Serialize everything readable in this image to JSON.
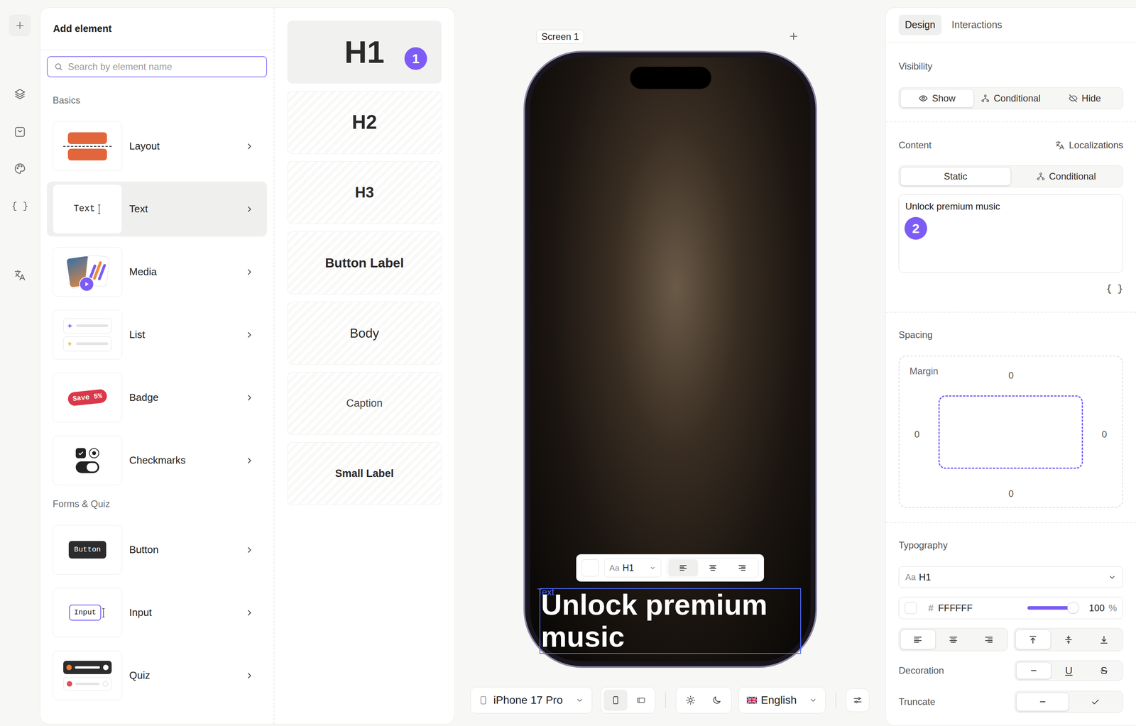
{
  "rail": {
    "code_icon": "{ }"
  },
  "left_panel": {
    "title": "Add element",
    "search": {
      "placeholder": "Search by element name"
    },
    "sections": [
      {
        "title": "Basics",
        "items": [
          {
            "label": "Layout",
            "kind": "layout",
            "selected": false
          },
          {
            "label": "Text",
            "kind": "text",
            "thumb_text": "Text",
            "selected": true
          },
          {
            "label": "Media",
            "kind": "media",
            "selected": false
          },
          {
            "label": "List",
            "kind": "list",
            "selected": false
          },
          {
            "label": "Badge",
            "kind": "badge",
            "thumb_text": "Save 5%",
            "selected": false
          },
          {
            "label": "Checkmarks",
            "kind": "checkmarks",
            "selected": false
          }
        ]
      },
      {
        "title": "Forms & Quiz",
        "items": [
          {
            "label": "Button",
            "kind": "button",
            "thumb_text": "Button",
            "selected": false
          },
          {
            "label": "Input",
            "kind": "input",
            "thumb_text": "Input",
            "selected": false
          },
          {
            "label": "Quiz",
            "kind": "quiz",
            "selected": false
          }
        ]
      }
    ]
  },
  "text_styles": [
    {
      "label": "H1",
      "kind": "h1",
      "selected": true,
      "badge": "1"
    },
    {
      "label": "H2",
      "kind": "h2",
      "selected": false
    },
    {
      "label": "H3",
      "kind": "h3",
      "selected": false
    },
    {
      "label": "Button Label",
      "kind": "button",
      "selected": false
    },
    {
      "label": "Body",
      "kind": "body",
      "selected": false
    },
    {
      "label": "Caption",
      "kind": "caption",
      "selected": false
    },
    {
      "label": "Small Label",
      "kind": "small",
      "selected": false
    }
  ],
  "canvas": {
    "screen_label": "Screen 1",
    "selection_label": "Text",
    "headline": "Unlock premium music",
    "toolbar": {
      "style_prefix": "Aa",
      "style": "H1",
      "align": [
        {
          "selected": true
        },
        {
          "selected": false
        },
        {
          "selected": false
        }
      ]
    }
  },
  "bottom_bar": {
    "device": "iPhone 17 Pro",
    "orientation": [
      {
        "selected": true
      },
      {
        "selected": false
      }
    ],
    "theme": [
      {
        "selected": false
      },
      {
        "selected": false
      }
    ],
    "language": "English"
  },
  "inspector": {
    "tabs": [
      {
        "label": "Design",
        "selected": true
      },
      {
        "label": "Interactions",
        "selected": false
      }
    ],
    "visibility": {
      "title": "Visibility",
      "options": [
        {
          "label": "Show",
          "selected": true
        },
        {
          "label": "Conditional",
          "selected": false
        },
        {
          "label": "Hide",
          "selected": false
        }
      ]
    },
    "content": {
      "title": "Content",
      "localizations": "Localizations",
      "modes": [
        {
          "label": "Static",
          "selected": true
        },
        {
          "label": "Conditional",
          "selected": false
        }
      ],
      "text": "Unlock premium music",
      "badge": "2",
      "variables": "{ }"
    },
    "spacing": {
      "title": "Spacing",
      "margin_label": "Margin",
      "top": "0",
      "left": "0",
      "right": "0",
      "bottom": "0"
    },
    "typography": {
      "title": "Typography",
      "style_prefix": "Aa",
      "style": "H1",
      "color_prefix": "#",
      "color": "FFFFFF",
      "opacity": {
        "level": 1,
        "reading": "100",
        "unit": "%"
      },
      "align": [
        {
          "selected": true
        },
        {
          "selected": false
        },
        {
          "selected": false
        }
      ],
      "vertical_align": [
        {
          "selected": true
        },
        {
          "selected": false
        },
        {
          "selected": false
        }
      ],
      "decoration_label": "Decoration",
      "decoration": [
        {
          "kind": "none",
          "selected": true
        },
        {
          "kind": "underline",
          "glyph": "U",
          "selected": false
        },
        {
          "kind": "strike",
          "glyph": "S",
          "selected": false
        }
      ],
      "truncate_label": "Truncate",
      "truncate": [
        {
          "selected": true
        },
        {
          "selected": false
        }
      ]
    }
  }
}
